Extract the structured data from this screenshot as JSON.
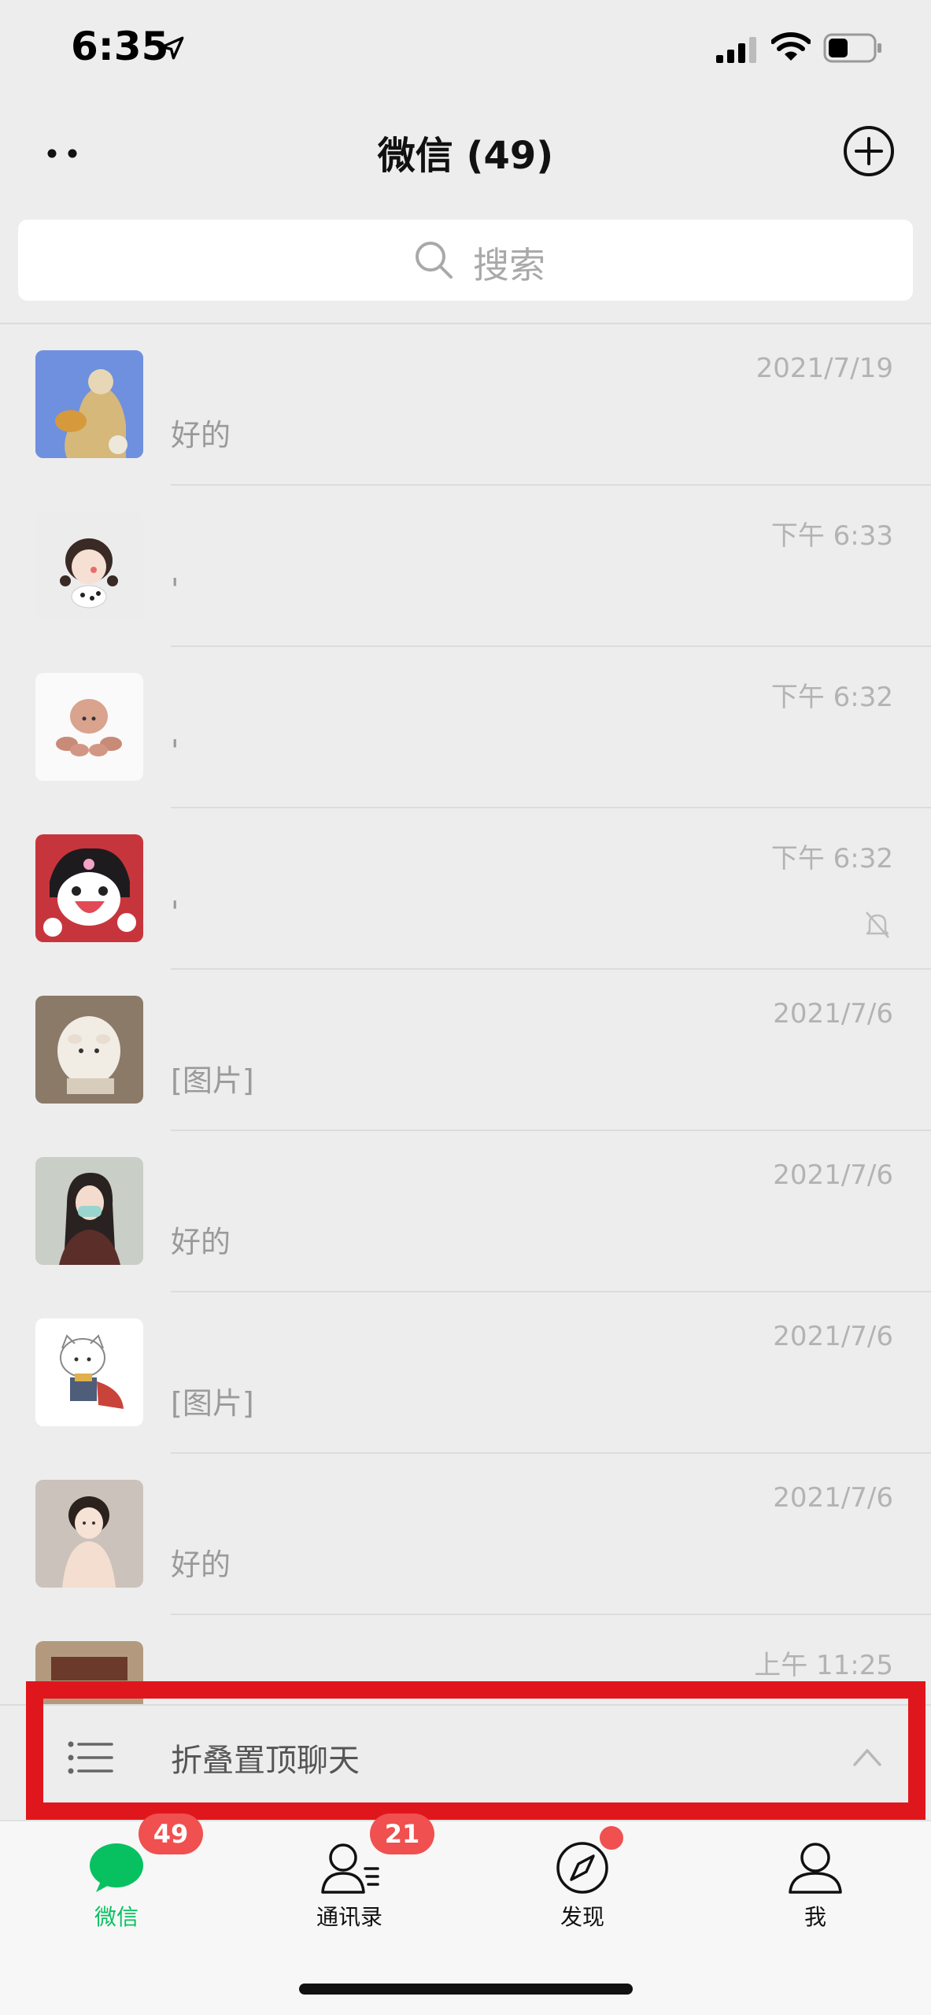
{
  "status_bar": {
    "time": "6:35"
  },
  "header": {
    "title": "微信 (49)"
  },
  "search": {
    "placeholder": "搜索"
  },
  "chats": [
    {
      "time": "2021/7/19",
      "preview": "好的",
      "muted": false
    },
    {
      "time": "下午 6:33",
      "preview": "'",
      "muted": false
    },
    {
      "time": "下午 6:32",
      "preview": "'",
      "muted": false
    },
    {
      "time": "下午 6:32",
      "preview": "'",
      "muted": true
    },
    {
      "time": "2021/7/6",
      "preview": "[图片]",
      "muted": false
    },
    {
      "time": "2021/7/6",
      "preview": "好的",
      "muted": false
    },
    {
      "time": "2021/7/6",
      "preview": "[图片]",
      "muted": false
    },
    {
      "time": "2021/7/6",
      "preview": "好的",
      "muted": false
    },
    {
      "time": "上午 11:25",
      "preview": "",
      "muted": false
    }
  ],
  "folded": {
    "label": "折叠置顶聊天"
  },
  "tabs": [
    {
      "label": "微信",
      "badge": "49",
      "active": true
    },
    {
      "label": "通讯录",
      "badge": "21",
      "active": false
    },
    {
      "label": "发现",
      "badge": "",
      "dot": true,
      "active": false
    },
    {
      "label": "我",
      "badge": "",
      "active": false
    }
  ],
  "colors": {
    "accent": "#07c160",
    "badge": "#f0504f",
    "highlight": "#e0161d",
    "background": "#ededed"
  }
}
